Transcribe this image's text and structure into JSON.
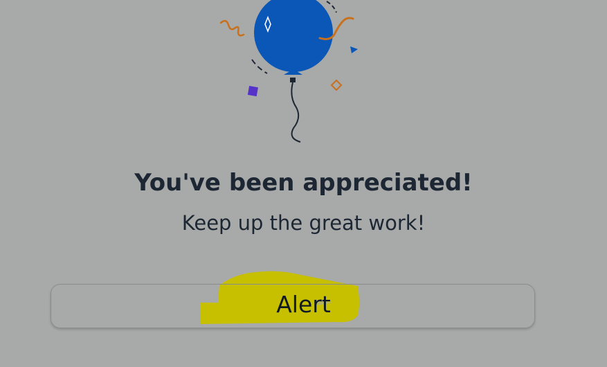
{
  "message": {
    "title": "You've been appreciated!",
    "subtitle": "Keep up the great work!"
  },
  "actions": {
    "alert_label": "Alert"
  },
  "illustration": {
    "icon": "balloon-icon",
    "balloon_color": "#0a57b8",
    "accent_orange": "#c9701c",
    "accent_purple": "#5533c8"
  },
  "annotation": {
    "highlight_color": "#c6c000"
  }
}
